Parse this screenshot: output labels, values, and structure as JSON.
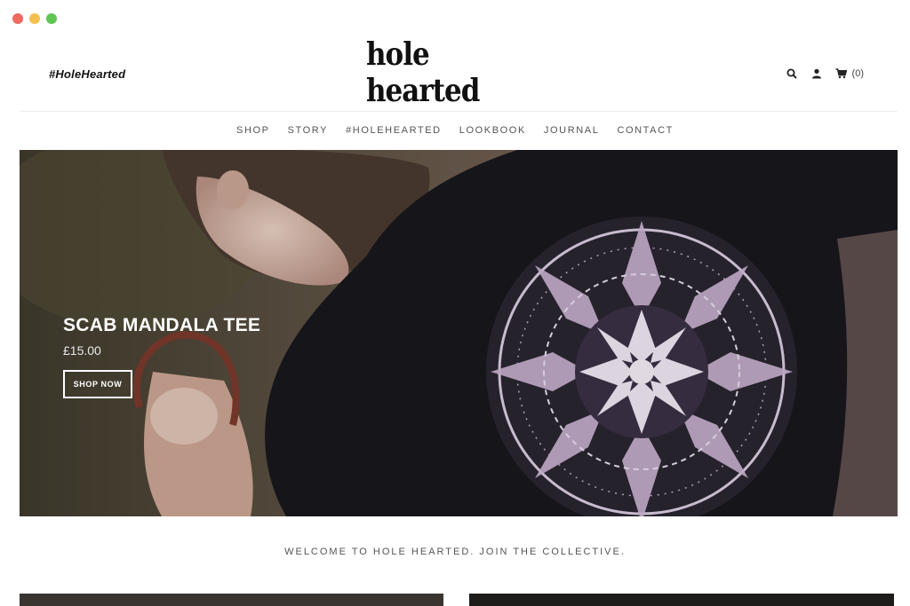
{
  "window": {
    "dots": [
      "#ed6a5e",
      "#f5bf4f",
      "#61c554"
    ]
  },
  "header": {
    "hashtag": "#HoleHearted",
    "logo": "hole hearted",
    "icons": [
      "search-icon",
      "user-icon",
      "cart-icon"
    ],
    "cart_count": "(0)"
  },
  "nav": {
    "items": [
      "SHOP",
      "STORY",
      "#HOLEHEARTED",
      "LOOKBOOK",
      "JOURNAL",
      "CONTACT"
    ]
  },
  "hero": {
    "title": "SCAB MANDALA TEE",
    "price": "£15.00",
    "button": "SHOP NOW"
  },
  "welcome": "WELCOME TO HOLE HEARTED. JOIN THE COLLECTIVE.",
  "colors": {
    "accent_text": "#111111",
    "nav_text": "#555555"
  }
}
